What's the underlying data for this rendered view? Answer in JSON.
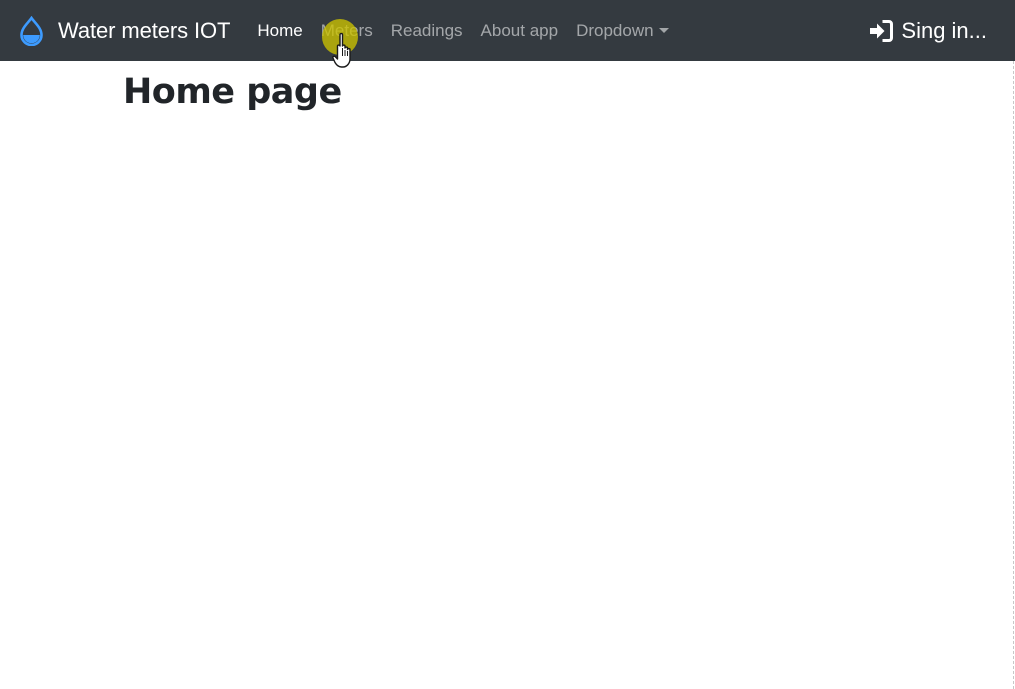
{
  "navbar": {
    "brand": {
      "icon": "water-drop-icon",
      "icon_color": "#3d9bff",
      "title": "Water meters IOT"
    },
    "links": [
      {
        "label": "Home",
        "active": true
      },
      {
        "label": "Meters",
        "active": false
      },
      {
        "label": "Readings",
        "active": false
      },
      {
        "label": "About app",
        "active": false
      },
      {
        "label": "Dropdown",
        "active": false
      }
    ],
    "signin": {
      "icon": "sign-in-icon",
      "label": "Sing in..."
    },
    "background_color": "#343a40"
  },
  "content": {
    "heading": "Home page"
  },
  "cursor": {
    "icon": "hand-pointer-icon",
    "highlight_color": "#ccc300"
  }
}
